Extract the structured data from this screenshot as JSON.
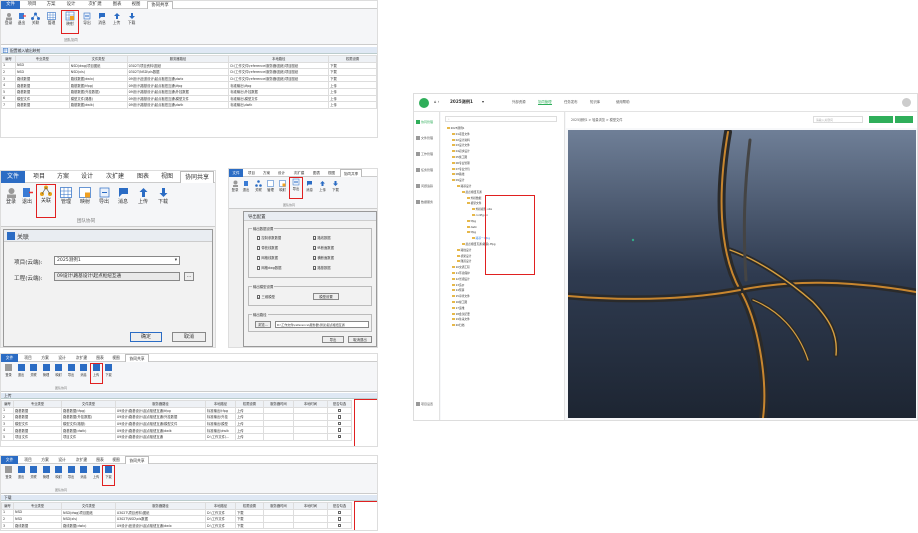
{
  "tabs": [
    "文件",
    "项目",
    "方案",
    "设计",
    "次扩建",
    "图表",
    "视图",
    "协同共享"
  ],
  "ribbon": {
    "login": "登录",
    "logout": "退出",
    "link": "关联",
    "manage": "管理",
    "map": "映射",
    "export": "导出",
    "message": "消息",
    "upload": "上传",
    "download": "下载",
    "group": "团队协同"
  },
  "config": {
    "title": "配置输入输出映射",
    "headers": [
      "编号",
      "专业类型",
      "文件类型",
      "服务器路径",
      "本地路径",
      "权限设置"
    ],
    "rows": [
      [
        "1",
        "NSD",
        "NSD(dwg)项目图纸",
        "0302T\\项目资料\\图纸",
        "D:\\工作文件\\reference\\服务器\\图纸\\项目图纸",
        "下载"
      ],
      [
        "2",
        "NSD",
        "NSD(xls)",
        "0302T\\NSD\\xls数据",
        "D:\\工作文件\\reference\\服务器\\图纸\\项目图纸",
        "下载"
      ],
      [
        "3",
        "路线数据",
        "路线数据(dwlx)",
        "09设计\\匝道设计\\起点枢纽互通\\dwlx",
        "D:\\工作文件\\reference\\服务器\\图纸\\项目图纸",
        "下载"
      ],
      [
        "4",
        "路基数据",
        "路基数据(tfpg)",
        "09设计\\路基设计\\起点枢纽互通\\tfpg",
        "标准输出\\tfpg",
        "上传"
      ],
      [
        "5",
        "路基数据",
        "路基数据(外挂数据)",
        "09设计\\路基设计\\起点枢纽互通\\外挂数据",
        "标准输出\\外挂数据",
        "上传"
      ],
      [
        "6",
        "模型文件",
        "模型文件(路基)",
        "09设计\\路基设计\\起点枢纽互通\\模型文件",
        "标准输出\\模型文件",
        "上传"
      ],
      [
        "7",
        "路基数据",
        "路基数据(dwlk)",
        "09设计\\路基设计\\起点枢纽互通\\dwlk",
        "标准输出\\dwlk",
        "上传"
      ]
    ]
  },
  "link_dialog": {
    "title": "关联",
    "project_label": "项目(云端):",
    "project_value": "2025测例1",
    "work_label": "工程(云端):",
    "work_value": "09设计\\路基设计\\起点枢纽互通",
    "browse": "...",
    "ok": "确定",
    "cancel": "取消"
  },
  "export_dialog": {
    "title": "导出配置",
    "sec1": "输出数据设置",
    "items": [
      "控制参数数据",
      "路线数据",
      "带桩线数据",
      "纵断面数据",
      "网格线数据",
      "横断面数据",
      "网格dwg数据",
      "路基数据"
    ],
    "sec2": "输出模型设置",
    "model_opt": "三维模型",
    "model_btn": "模型设置",
    "sec3": "输出路径",
    "browse": "浏览...",
    "path": "D:\\工作文件\\reference\\服务器\\测试\\起点枢纽互通",
    "export": "导出",
    "cancel": "取消退出"
  },
  "upload": {
    "title": "上传",
    "headers": [
      "编号",
      "专业类型",
      "文件类型",
      "服务器路径",
      "本地路径",
      "权限设置",
      "服务器时间",
      "本地时间",
      "是否勾选"
    ],
    "rows": [
      [
        "1",
        "路基数据",
        "路基数据(tfpg)",
        "09设计\\路基设计\\起点枢纽互通\\tfpg",
        "标准输出\\tfpg",
        "上传"
      ],
      [
        "2",
        "路基数据",
        "路基数据(外挂数据)",
        "09设计\\路基设计\\起点枢纽互通\\外挂数据",
        "标准输出\\外挂",
        "上传"
      ],
      [
        "3",
        "模型文件",
        "模型文件(路基)",
        "09设计\\路基设计\\起点枢纽互通\\模型文件",
        "标准输出\\模型",
        "上传"
      ],
      [
        "4",
        "路基数据",
        "路基数据(dwlk)",
        "09设计\\路基设计\\起点枢纽互通\\dwlk",
        "标准输出\\dwlk",
        "上传"
      ],
      [
        "5",
        "项目文件",
        "项目文件",
        "09设计\\路基设计\\起点枢纽互通",
        "D:\\工作文件\\...",
        "上传"
      ]
    ]
  },
  "download": {
    "title": "下载",
    "headers": [
      "编号",
      "专业类型",
      "文件类型",
      "服务器路径",
      "本地路径",
      "权限设置",
      "服务器时间",
      "本地时间",
      "是否勾选"
    ],
    "rows": [
      [
        "1",
        "NSD",
        "NSD(dwg)项目图纸",
        "0302T\\项目资料\\图纸",
        "D:\\工作文件",
        "下载"
      ],
      [
        "2",
        "NSD",
        "NSD(xls)",
        "0302T\\NSD\\xls数据",
        "D:\\工作文件",
        "下载"
      ],
      [
        "3",
        "路线数据",
        "路线数据(dwlx)",
        "09设计\\匝道设计\\起点枢纽互通\\dwlx",
        "D:\\工作文件",
        "下载"
      ]
    ]
  },
  "web": {
    "project": "2025测例1",
    "top_tabs": [
      "外部资源",
      "协同管理",
      "任务发布",
      "知识库",
      "使用帮助"
    ],
    "side": [
      "协同管理",
      "文件管理",
      "工作管理",
      "任务管理",
      "问题追踪",
      "数据服务",
      "项目设置"
    ],
    "breadcrumb": "2025测例1 > 轻量浏览 > 模型文件",
    "search_placeholder": "请输入关键词",
    "tree": [
      "2025测例1",
      "01项目文件",
      "02设计资料",
      "03设计文件",
      "04初步设计",
      "05施工图",
      "06专业管理",
      "07专业分包",
      "08路线",
      "09设计",
      "路基设计",
      "起点枢纽互通",
      "外挂数据",
      "模型文件",
      "外挂模型.obx",
      "config.ini",
      "tfpg",
      "dwlk",
      "tfpg",
      "路基一.tfpg",
      "起点枢纽互通(路基).tfpg",
      "路线设计",
      "桥梁设计",
      "隧道设计",
      "10交通工程",
      "11环境保护",
      "12景观设计",
      "13造价",
      "14预算",
      "15审查文件",
      "16竣工图",
      "17运维",
      "18会议纪要",
      "19往来文件",
      "20归档"
    ]
  }
}
